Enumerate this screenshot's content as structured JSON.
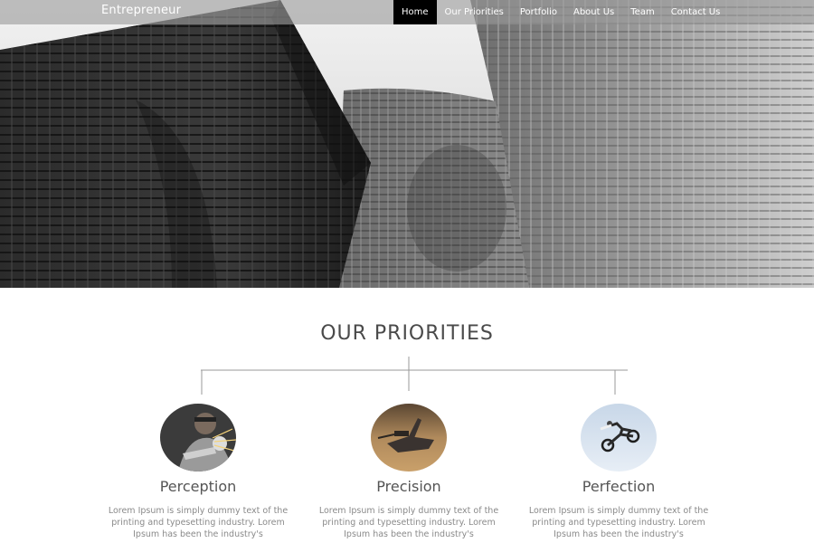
{
  "brand": "Entrepreneur",
  "nav": {
    "items": [
      "Home",
      "Our Priorities",
      "Portfolio",
      "About Us",
      "Team",
      "Contact Us"
    ],
    "active_index": 0
  },
  "priorities": {
    "title": "OUR PRIORITIES",
    "cards": [
      {
        "title": "Perception",
        "text": "Lorem Ipsum is simply dummy text of the printing and typesetting industry. Lorem Ipsum has been the industry's"
      },
      {
        "title": "Precision",
        "text": "Lorem Ipsum is simply dummy text of the printing and typesetting industry. Lorem Ipsum has been the industry's"
      },
      {
        "title": "Perfection",
        "text": "Lorem Ipsum is simply dummy text of the printing and typesetting industry. Lorem Ipsum has been the industry's"
      }
    ]
  },
  "colors": {
    "nav_active_bg": "#000000",
    "nav_bar_bg": "#9b9b9b",
    "title_text": "#4a4a4a",
    "body_text": "#8a8a8a"
  }
}
